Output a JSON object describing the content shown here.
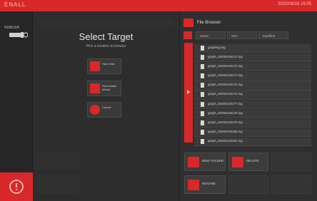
{
  "header": {
    "app_title": "ENALL",
    "datetime": "2020/08/16 16:05"
  },
  "sidebar": {
    "usb_label": "NUBUSR"
  },
  "dialog": {
    "title": "Select Target",
    "subtitle": "Pick a location to browse",
    "options": [
      {
        "label": "Hard Disk",
        "icon": "harddisk-icon"
      },
      {
        "label": "Removable Media",
        "icon": "usb-drive-icon"
      },
      {
        "label": "Cancel",
        "icon": "close-icon"
      }
    ]
  },
  "browser": {
    "title": "File Browser",
    "tabs": [
      "Name",
      "Size",
      "Modified"
    ],
    "files": [
      "graphing.log",
      "graph_20200416172.log",
      "graph_20200416173.log",
      "graph_20200416174.log",
      "graph_20200416175.log",
      "graph_20200416176.log",
      "graph_20200416177.log",
      "graph_20200416178.log",
      "graph_20200416179.log",
      "graph_20200416180.log",
      "graph_20200416181.log"
    ],
    "actions": {
      "new_folder": "NEW FOLDER",
      "delete": "DELETE",
      "rename": "RENAME"
    }
  },
  "colors": {
    "accent": "#d9282a",
    "panel": "#2f2f2f",
    "background": "#2a2a2a"
  }
}
